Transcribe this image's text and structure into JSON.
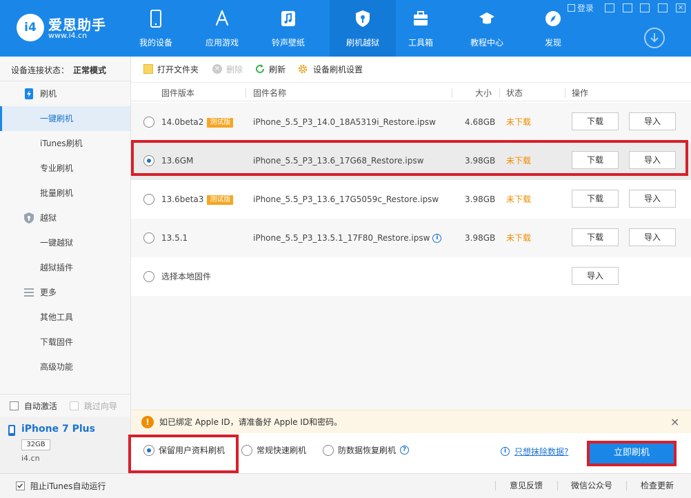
{
  "app": {
    "name": "爱思助手",
    "url": "www.i4.cn",
    "logo_text": "i4"
  },
  "nav": [
    {
      "label": "我的设备",
      "icon": "phone-icon"
    },
    {
      "label": "应用游戏",
      "icon": "app-store-icon"
    },
    {
      "label": "铃声壁纸",
      "icon": "music-icon"
    },
    {
      "label": "刷机越狱",
      "icon": "shield-icon"
    },
    {
      "label": "工具箱",
      "icon": "toolbox-icon"
    },
    {
      "label": "教程中心",
      "icon": "graduation-cap-icon"
    },
    {
      "label": "发现",
      "icon": "compass-icon"
    }
  ],
  "window": {
    "login": "登录"
  },
  "sidebar": {
    "status_label": "设备连接状态：",
    "status_value": "正常模式",
    "sections": [
      {
        "title": "刷机",
        "icon": "flash-phone-icon",
        "items": [
          "一键刷机",
          "iTunes刷机",
          "专业刷机",
          "批量刷机"
        ]
      },
      {
        "title": "越狱",
        "icon": "jailbreak-shield-icon",
        "items": [
          "一键越狱",
          "越狱插件"
        ]
      },
      {
        "title": "更多",
        "icon": "menu-lines-icon",
        "items": [
          "其他工具",
          "下载固件",
          "高级功能"
        ]
      }
    ],
    "auto_activate": "自动激活",
    "skip_guide": "跳过向导",
    "device_name": "iPhone 7 Plus",
    "device_capacity": "32GB",
    "device_site": "i4.cn"
  },
  "toolbar": {
    "open_folder": "打开文件夹",
    "delete": "删除",
    "refresh": "刷新",
    "settings": "设备刷机设置"
  },
  "table": {
    "headers": [
      "固件版本",
      "固件名称",
      "大小",
      "状态",
      "操作"
    ],
    "rows": [
      {
        "version": "14.0beta2",
        "badge": "测试版",
        "name": "iPhone_5.5_P3_14.0_18A5319i_Restore.ipsw",
        "size": "4.68GB",
        "status": "未下载",
        "download": "下载",
        "import": "导入",
        "selected": false
      },
      {
        "version": "13.6GM",
        "badge": "",
        "name": "iPhone_5.5_P3_13.6_17G68_Restore.ipsw",
        "size": "3.98GB",
        "status": "未下载",
        "download": "下载",
        "import": "导入",
        "selected": true
      },
      {
        "version": "13.6beta3",
        "badge": "测试版",
        "name": "iPhone_5.5_P3_13.6_17G5059c_Restore.ipsw",
        "size": "3.98GB",
        "status": "未下载",
        "download": "下载",
        "import": "导入",
        "selected": false
      },
      {
        "version": "13.5.1",
        "badge": "",
        "name": "iPhone_5.5_P3_13.5.1_17F80_Restore.ipsw",
        "size": "3.98GB",
        "status": "未下载",
        "download": "下载",
        "import": "导入",
        "selected": false
      }
    ],
    "local_row": {
      "label": "选择本地固件",
      "import": "导入"
    }
  },
  "notice": {
    "text": "如已绑定 Apple ID，请准备好 Apple ID和密码。"
  },
  "options": {
    "keep_data": "保留用户资料刷机",
    "fast": "常规快速刷机",
    "recovery": "防数据恢复刷机",
    "erase_link": "只想抹除数据?",
    "flash_button": "立即刷机"
  },
  "footer": {
    "block_itunes": "阻止iTunes自动运行",
    "feedback": "意见反馈",
    "wechat": "微信公众号",
    "update": "检查更新"
  },
  "colors": {
    "brand": "#1a87e8",
    "highlight": "#d6202a",
    "status": "#f08c00"
  }
}
